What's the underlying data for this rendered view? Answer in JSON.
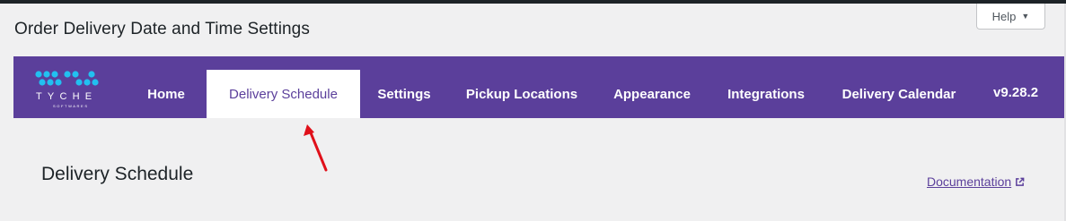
{
  "header": {
    "title": "Order Delivery Date and Time Settings",
    "help_label": "Help",
    "help_caret": "▼"
  },
  "nav": {
    "logo_text": "TYCHE",
    "logo_subtext": "SOFTWARES",
    "tabs": [
      {
        "label": "Home"
      },
      {
        "label": "Delivery Schedule",
        "active": true
      },
      {
        "label": "Settings"
      },
      {
        "label": "Pickup Locations"
      },
      {
        "label": "Appearance"
      },
      {
        "label": "Integrations"
      },
      {
        "label": "Delivery Calendar"
      }
    ],
    "version": "v9.28.2"
  },
  "content": {
    "section_title": "Delivery Schedule",
    "documentation_link": "Documentation"
  },
  "colors": {
    "nav_background": "#5b3f9b",
    "logo_dot": "#22c0f0",
    "annotation_arrow": "#e0101a"
  },
  "icons": {
    "help_caret": "caret-down-icon",
    "external_link": "external-link-icon",
    "annotation": "red-arrow-annotation"
  }
}
